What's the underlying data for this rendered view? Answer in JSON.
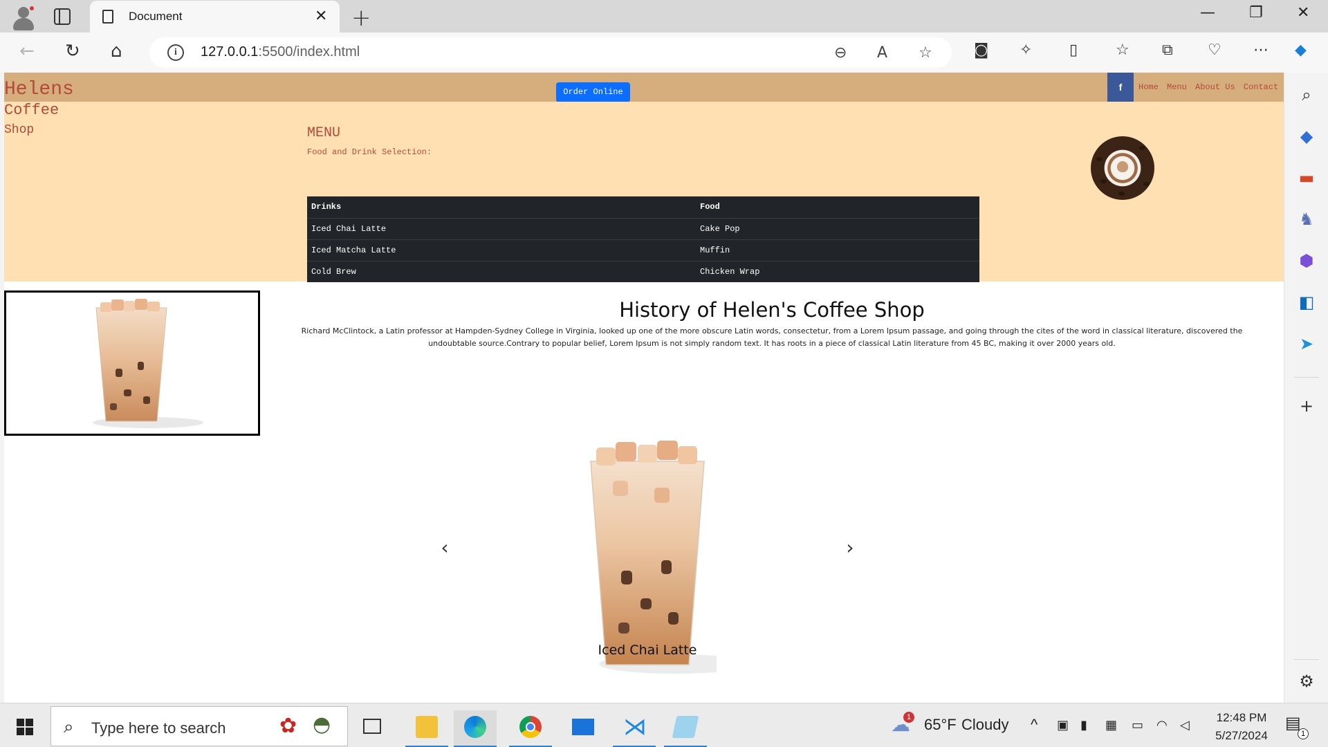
{
  "browser": {
    "tab_title": "Document",
    "url_host": "127.0.0.1",
    "url_rest": ":5500/index.html"
  },
  "site": {
    "brand_line1": "Helens",
    "brand_line2": "Coffee",
    "brand_line3": "Shop",
    "order_button": "Order Online",
    "facebook_label": "f",
    "nav": [
      "Home",
      "Menu",
      "About Us",
      "Contact Us"
    ],
    "menu_title": "MENU",
    "menu_subtitle": "Food and Drink Selection:",
    "menu_headers": [
      "Drinks",
      "Food"
    ],
    "menu_rows": [
      [
        "Iced Chai Latte",
        "Cake Pop"
      ],
      [
        "Iced Matcha Latte",
        "Muffin"
      ],
      [
        "Cold Brew",
        "Chicken Wrap"
      ]
    ],
    "history_title": "History of Helen's Coffee Shop",
    "history_text": "Richard McClintock, a Latin professor at Hampden-Sydney College in Virginia, looked up one of the more obscure Latin words, consectetur, from a Lorem Ipsum passage, and going through the cites of the word in classical literature, discovered the undoubtable source.Contrary to popular belief, Lorem Ipsum is not simply random text. It has roots in a piece of classical Latin literature from 45 BC, making it over 2000 years old.",
    "carousel_caption": "Iced Chai Latte",
    "carousel_prev": "‹",
    "carousel_next": "›"
  },
  "taskbar": {
    "search_placeholder": "Type here to search",
    "weather_temp": "65°F",
    "weather_desc": "Cloudy",
    "weather_badge": "1",
    "time": "12:48 PM",
    "date": "5/27/2024",
    "notification_count": "1"
  },
  "colors": {
    "header": "#d6ad7d",
    "menu_bg": "#ffe0b2",
    "brand_text": "#b34a3a",
    "order_button": "#0d6efd",
    "table_bg": "#212529",
    "facebook": "#3b5998"
  },
  "icons": {
    "edge_sidebar": [
      "search-icon",
      "shopping-tag-icon",
      "toolbox-icon",
      "chess-icon",
      "copilot-icon",
      "outlook-icon",
      "send-icon",
      "add-icon",
      "settings-icon"
    ]
  }
}
